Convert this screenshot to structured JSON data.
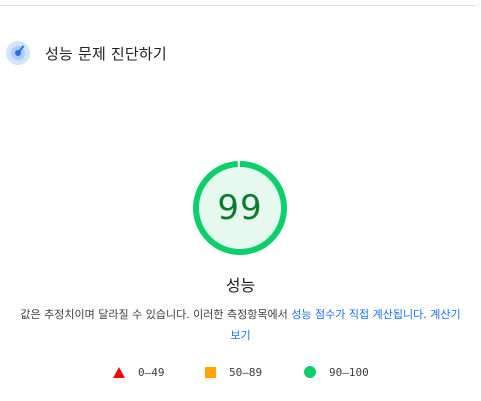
{
  "section": {
    "icon": "performance-gauge-icon",
    "title": "성능 문제 진단하기"
  },
  "gauge": {
    "score": "99",
    "score_fraction": 0.99,
    "colors": {
      "ring": "#0cce6b",
      "fill": "#e7f8ee",
      "text": "#0a7c2f"
    }
  },
  "metric_label": "성능",
  "description": {
    "text_before": "값은 추정치이며 달라질 수 있습니다. 이러한 측정항목에서 ",
    "link1": "성능 점수가 직접 계산됩니다",
    "text_middle": ". ",
    "link2": "계산기 보기"
  },
  "legend": [
    {
      "shape": "triangle",
      "color": "#eb0f00",
      "label": "0–49"
    },
    {
      "shape": "square",
      "color": "#ffa400",
      "label": "50–89"
    },
    {
      "shape": "circle",
      "color": "#0cce6b",
      "label": "90–100"
    }
  ]
}
